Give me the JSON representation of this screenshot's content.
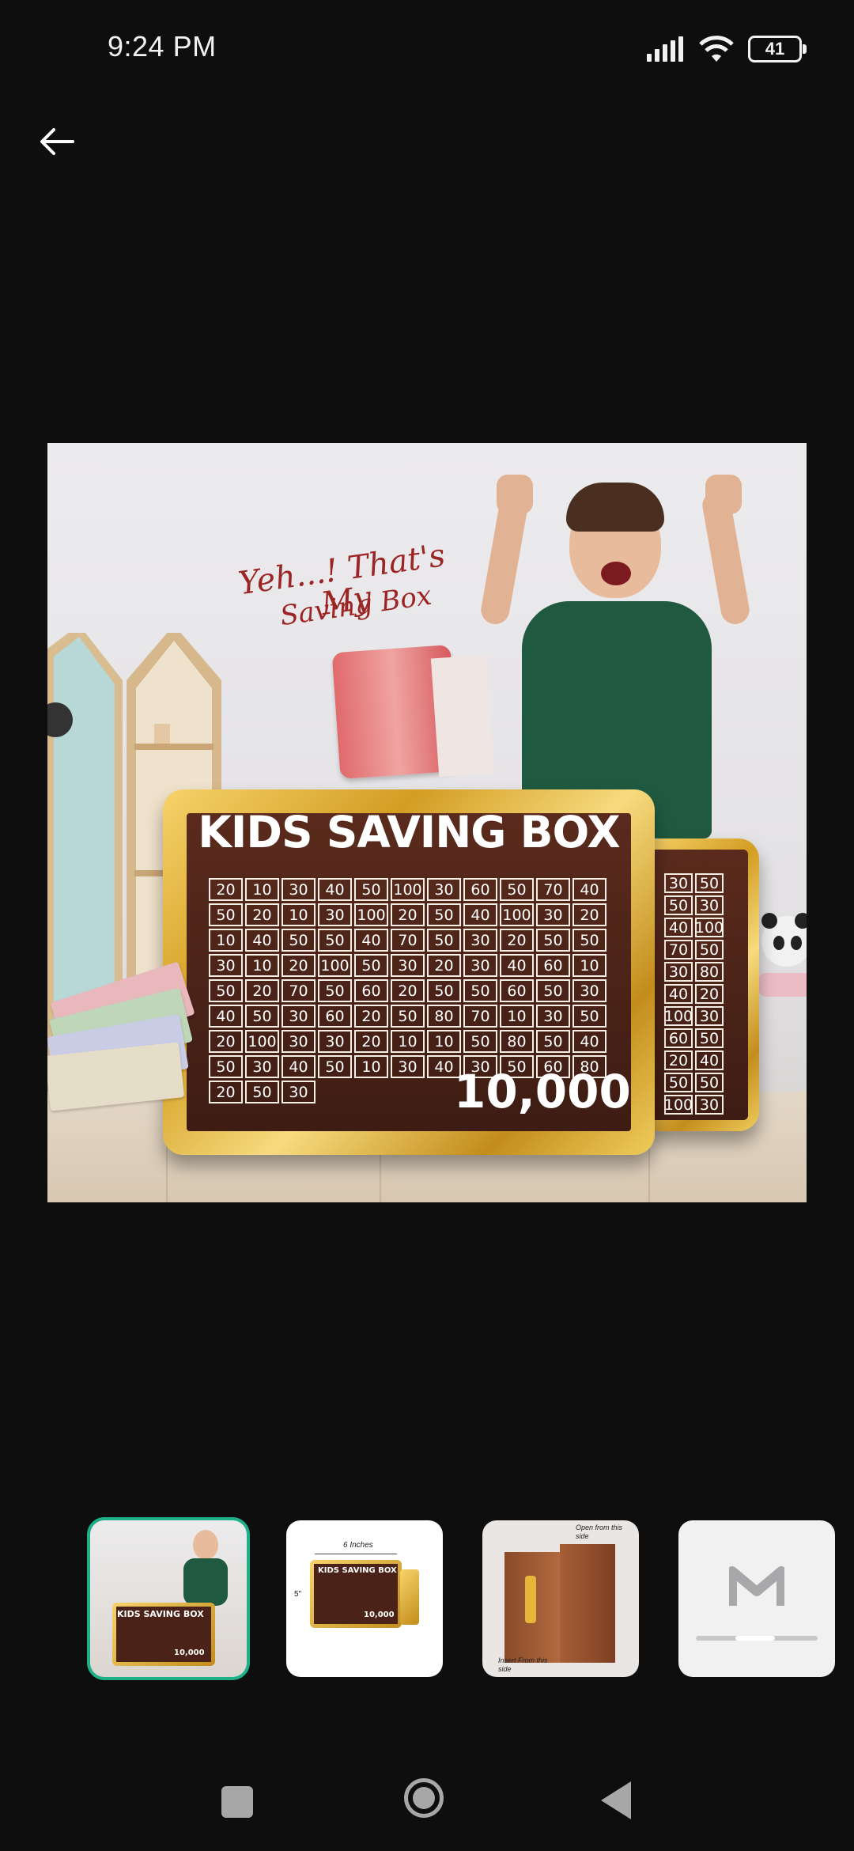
{
  "status_bar": {
    "time": "9:24 PM",
    "battery_level": "41",
    "icons": [
      "signal-icon",
      "wifi-icon",
      "battery-icon"
    ]
  },
  "header": {
    "back_icon": "arrow-left-icon"
  },
  "main_image": {
    "slogan_line1": "Yeh...! That's My",
    "slogan_line2": "Saving Box",
    "board_title": "KIDS SAVING BOX",
    "total": "10,000",
    "grid": [
      [
        "20",
        "10",
        "30",
        "40",
        "50",
        "100",
        "30",
        "60",
        "50",
        "70",
        "40"
      ],
      [
        "50",
        "20",
        "10",
        "30",
        "100",
        "20",
        "50",
        "40",
        "100",
        "30",
        "20"
      ],
      [
        "10",
        "40",
        "50",
        "50",
        "40",
        "70",
        "50",
        "30",
        "20",
        "50",
        "50"
      ],
      [
        "30",
        "10",
        "20",
        "100",
        "50",
        "30",
        "20",
        "30",
        "40",
        "60",
        "10"
      ],
      [
        "50",
        "20",
        "70",
        "50",
        "60",
        "20",
        "50",
        "50",
        "60",
        "50",
        "30"
      ],
      [
        "40",
        "50",
        "30",
        "60",
        "20",
        "50",
        "80",
        "70",
        "10",
        "30",
        "50"
      ],
      [
        "20",
        "100",
        "30",
        "30",
        "20",
        "10",
        "10",
        "50",
        "80",
        "50",
        "40"
      ],
      [
        "50",
        "30",
        "40",
        "50",
        "10",
        "30",
        "40"
      ],
      [
        "30",
        "50",
        "60",
        "80",
        "20",
        "50",
        "30"
      ]
    ],
    "back_board_grid": [
      [
        "30",
        "50"
      ],
      [
        "50",
        "30"
      ],
      [
        "40",
        "100"
      ],
      [
        "70",
        "50"
      ],
      [
        "30",
        "80"
      ],
      [
        "40",
        "20"
      ],
      [
        "100",
        "30"
      ],
      [
        "60",
        "50"
      ],
      [
        "20",
        "40"
      ],
      [
        "50",
        "50"
      ],
      [
        "100",
        "30"
      ]
    ]
  },
  "thumbnails": [
    {
      "label": "KIDS SAVING BOX",
      "total": "10,000",
      "selected": true
    },
    {
      "label": "KIDS SAVING BOX",
      "dimension_top": "6 Inches",
      "dimension_side": "5\"",
      "total": "10,000",
      "selected": false
    },
    {
      "caption_top": "Open from this side",
      "caption_bottom": "Insert From this side",
      "selected": false
    },
    {
      "icon": "m-logo-icon",
      "selected": false
    }
  ],
  "colors": {
    "background": "#0e0e0f",
    "selected_outline": "#1fb08a",
    "gold": "#d39d23",
    "board_brown": "#4a2217"
  }
}
